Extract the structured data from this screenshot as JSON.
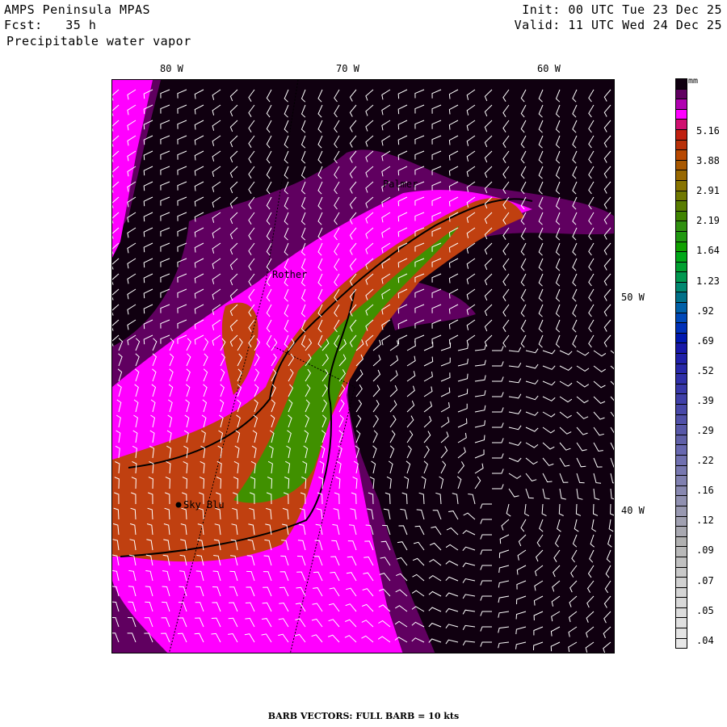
{
  "header": {
    "model": "AMPS Peninsula MPAS",
    "forecast": "Fcst:   35 h",
    "field": "Precipitable water vapor",
    "init": "Init: 00 UTC Tue 23 Dec 25",
    "valid": "Valid: 11 UTC Wed 24 Dec 25"
  },
  "axes": {
    "top_labels": [
      "80 W",
      "70 W",
      "60 W"
    ],
    "right_labels": [
      "50 W",
      "40 W"
    ]
  },
  "stations": [
    "Palmer",
    "Rother",
    "Sky Blu"
  ],
  "colorbar": {
    "unit": "mm",
    "labels": [
      "5.16",
      "3.88",
      "2.91",
      "2.19",
      "1.64",
      "1.23",
      ".92",
      ".69",
      ".52",
      ".39",
      ".29",
      ".22",
      ".16",
      ".12",
      ".09",
      ".07",
      ".05",
      ".04"
    ],
    "colors": [
      "#100010",
      "#600060",
      "#b000b0",
      "#ff00ff",
      "#d01070",
      "#c02010",
      "#b83008",
      "#b84800",
      "#a85800",
      "#986800",
      "#887400",
      "#707800",
      "#587c00",
      "#408400",
      "#309010",
      "#209810",
      "#10a000",
      "#00a818",
      "#00a030",
      "#009850",
      "#008870",
      "#007088",
      "#0060a8",
      "#0048b8",
      "#0030b8",
      "#0018b0",
      "#1818a8",
      "#2020a8",
      "#2828a8",
      "#3030a8",
      "#3838a8",
      "#4040a8",
      "#4848a8",
      "#5050a8",
      "#5858a8",
      "#6060a8",
      "#6868b0",
      "#7070b0",
      "#7878b0",
      "#8080b0",
      "#8888b0",
      "#9090b0",
      "#9898b0",
      "#a0a0b0",
      "#a8a8b0",
      "#b0b0b0",
      "#b8b8b8",
      "#c0c0c0",
      "#c8c8c8",
      "#d0d0d0",
      "#d4d4d4",
      "#d8d8d8",
      "#dcdcdc",
      "#e0e0e0",
      "#e4e4e4",
      "#e8e8e8"
    ]
  },
  "footer": "BARB VECTORS:  FULL BARB = 10 kts"
}
